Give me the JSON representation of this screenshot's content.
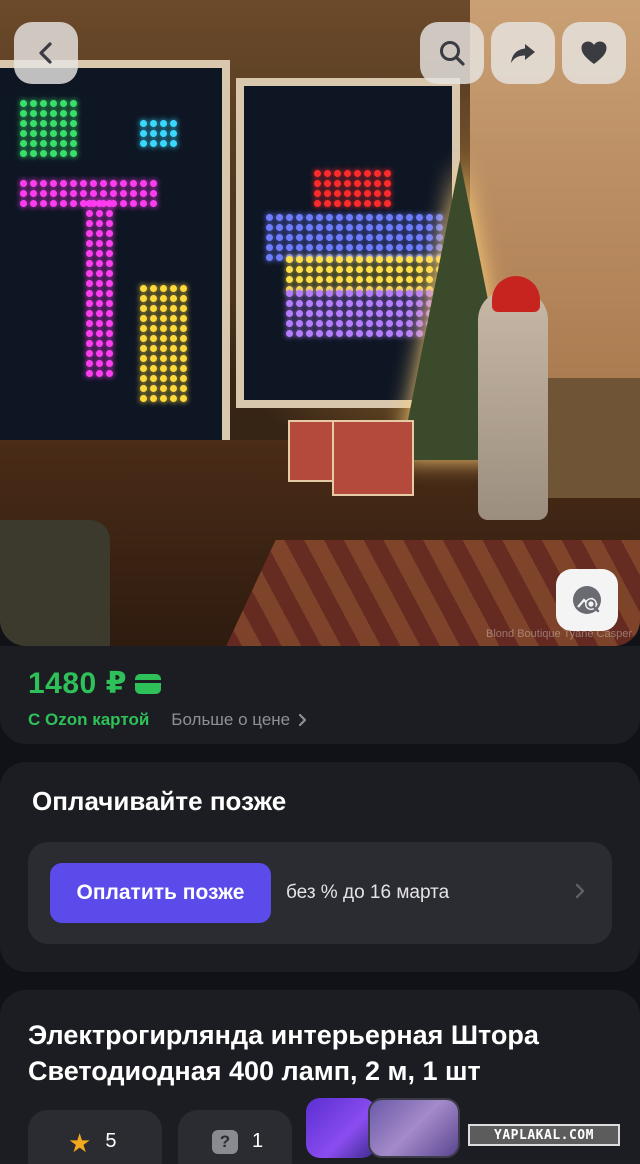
{
  "product": {
    "image_alt_lens": "visual-search",
    "price": "1480 ₽",
    "ozon_card_label": "С Ozon картой",
    "more_price_label": "Больше о цене",
    "title": "Электрогирлянда интерьерная Штора Светодиодная 400 ламп, 2 м, 1 шт",
    "rating": "5",
    "questions": "1"
  },
  "pay_later": {
    "heading": "Оплачивайте позже",
    "button_label": "Оплатить позже",
    "terms": "без % до 16 марта"
  },
  "icons": [
    "back-arrow-icon",
    "search-icon",
    "share-icon",
    "heart-icon",
    "image-search-icon",
    "card-icon",
    "chevron-right-icon",
    "star-icon",
    "question-icon"
  ],
  "colors": {
    "accent_green": "#2ec15a",
    "pay_later_purple": "#5b4bea",
    "card_bg": "#1c1d22",
    "page_bg": "#111217"
  },
  "watermark": {
    "site": "YAPLAKAL.COM",
    "photo_credit": "Blond Boutique Tyane Casper"
  }
}
